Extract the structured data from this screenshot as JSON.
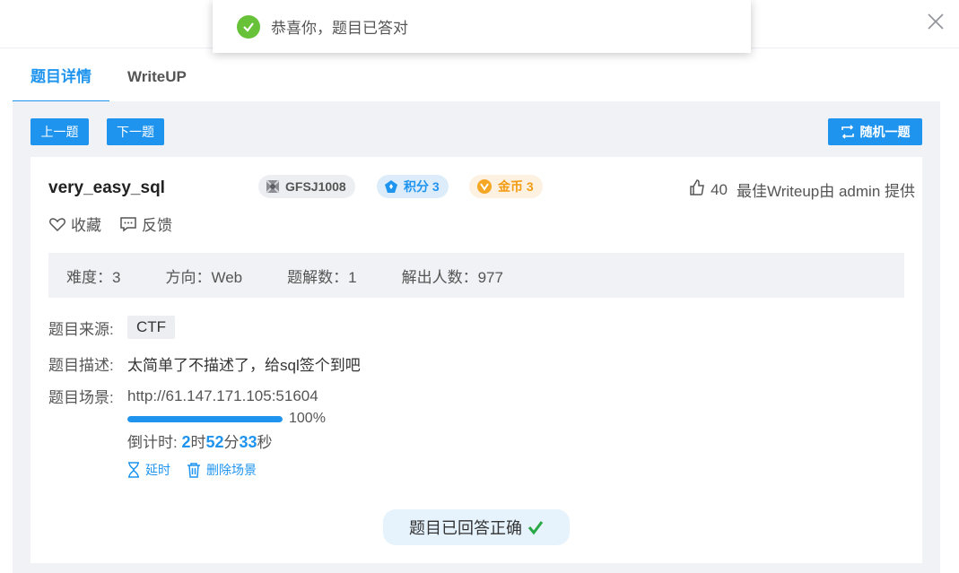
{
  "toast": {
    "message": "恭喜你，题目已答对",
    "icon": "check-circle-icon"
  },
  "tabs": [
    {
      "label": "题目详情"
    },
    {
      "label": "WriteUP"
    }
  ],
  "nav": {
    "prev_label": "上一题",
    "next_label": "下一题",
    "random_label": "随机一题"
  },
  "challenge": {
    "title": "very_easy_sql",
    "id": "GFSJ1008",
    "score_label": "积分 3",
    "coin_label": "金币 3",
    "likes": "40",
    "best_writeup": "最佳Writeup由 admin 提供",
    "favorite_label": "收藏",
    "feedback_label": "反馈"
  },
  "stats": [
    {
      "text": "难度：3"
    },
    {
      "text": "方向：Web"
    },
    {
      "text": "题解数：1"
    },
    {
      "text": "解出人数：977"
    }
  ],
  "info": {
    "source_label": "题目来源:",
    "source_value": "CTF",
    "desc_label": "题目描述:",
    "desc_value": "太简单了不描述了，给sql签个到吧",
    "scene_label": "题目场景:",
    "scene_value": "http://61.147.171.105:51604",
    "progress": 100,
    "progress_text": "100%",
    "countdown_prefix": "倒计时: ",
    "countdown_h": "2",
    "countdown_h_unit": "时",
    "countdown_m": "52",
    "countdown_m_unit": "分",
    "countdown_s": "33",
    "countdown_s_unit": "秒",
    "extend_label": "延时",
    "delete_label": "删除场景"
  },
  "result": {
    "label": "题目已回答正确"
  },
  "colors": {
    "accent": "#1f94ef",
    "success": "#67c23a",
    "coin": "#f39c12"
  }
}
